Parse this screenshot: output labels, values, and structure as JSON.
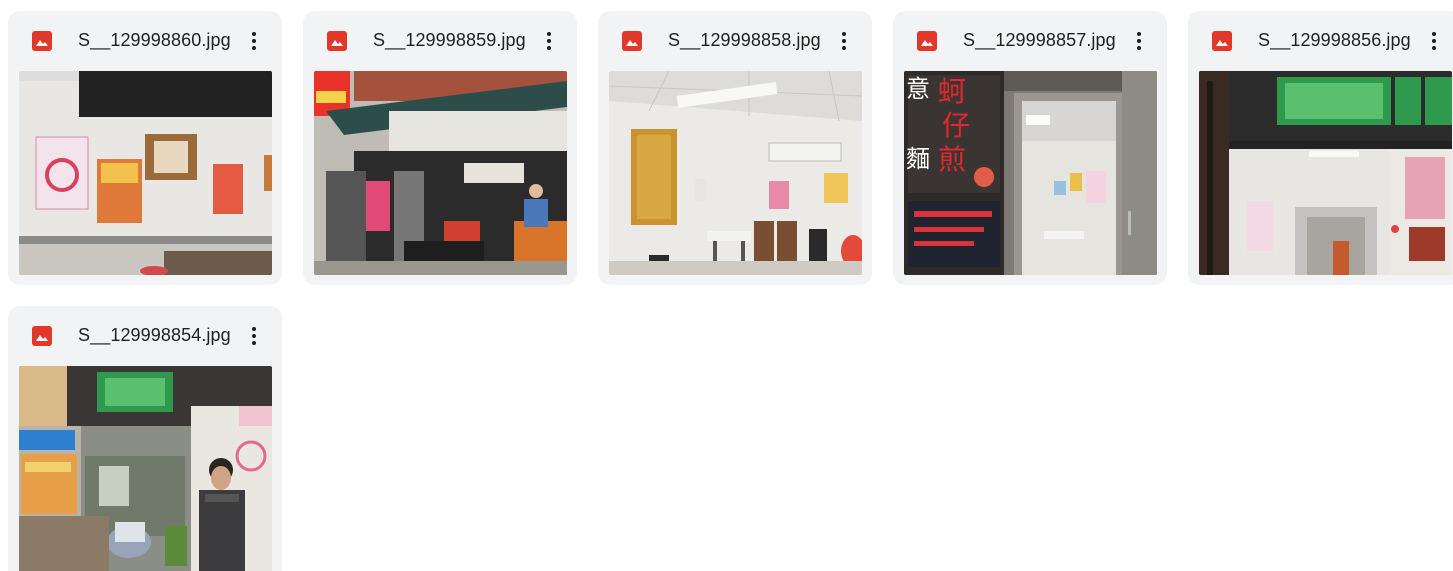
{
  "files": [
    {
      "name": "S__129998860.jpg",
      "type_icon": "image-file-icon",
      "menu_icon": "more-vert-icon"
    },
    {
      "name": "S__129998859.jpg",
      "type_icon": "image-file-icon",
      "menu_icon": "more-vert-icon"
    },
    {
      "name": "S__129998858.jpg",
      "type_icon": "image-file-icon",
      "menu_icon": "more-vert-icon"
    },
    {
      "name": "S__129998857.jpg",
      "type_icon": "image-file-icon",
      "menu_icon": "more-vert-icon"
    },
    {
      "name": "S__129998856.jpg",
      "type_icon": "image-file-icon",
      "menu_icon": "more-vert-icon"
    },
    {
      "name": "S__129998854.jpg",
      "type_icon": "image-file-icon",
      "menu_icon": "more-vert-icon"
    }
  ],
  "thumbnail_text": {
    "sign_1": "蚵",
    "sign_2": "仔",
    "sign_3": "煎",
    "sign_4": "意",
    "sign_5": "麵"
  },
  "colors": {
    "card_bg": "#f1f3f4",
    "icon_red": "#e2382b",
    "text": "#1f1f1f"
  }
}
